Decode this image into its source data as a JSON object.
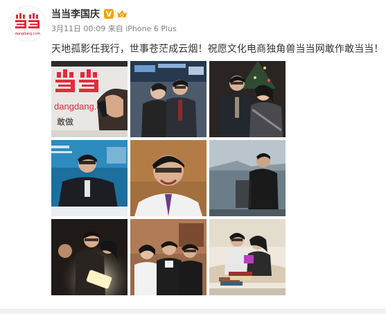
{
  "author": {
    "name": "当当李国庆",
    "avatar_sub": "dangdang.com",
    "verified_label": "V",
    "verified_icon": "verified-badge-icon",
    "vip_icon": "vip-crown-icon"
  },
  "meta": {
    "date": "3月11日",
    "time": "00:09",
    "from_label": "来自",
    "source": "iPhone 6 Plus"
  },
  "post": {
    "text": "天地孤影任我行，世事苍茫成云烟！祝愿文化电商独角兽当当网敢作敢当当！"
  },
  "photos": [
    {
      "name": "photo-dangdang-logo-phone"
    },
    {
      "name": "photo-couple-stock-exchange"
    },
    {
      "name": "photo-couple-christmas-tree"
    },
    {
      "name": "photo-man-seated-forum"
    },
    {
      "name": "photo-man-smiling-tv"
    },
    {
      "name": "photo-man-waterfront"
    },
    {
      "name": "photo-group-party-light"
    },
    {
      "name": "photo-group-of-three"
    },
    {
      "name": "photo-couple-sofa-books"
    }
  ],
  "photo_grid_labels": {
    "p1_logo": "dangdang.com",
    "p1_slogan": "敢做"
  },
  "colors": {
    "brand_red": "#e32b3b",
    "verified_orange": "#f7a200",
    "meta_gray": "#808080",
    "text_dark": "#333333"
  }
}
